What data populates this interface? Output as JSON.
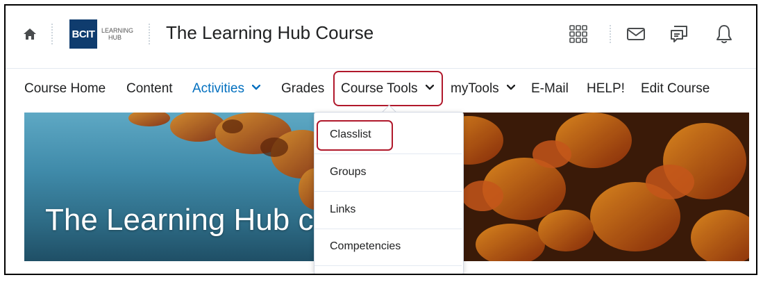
{
  "header": {
    "home_icon": "home-icon",
    "logo": {
      "brand": "BCIT",
      "line1": "LEARNING",
      "line2": "HUB"
    },
    "course_title": "The Learning Hub Course",
    "icons": [
      "apps-grid-icon",
      "mail-icon",
      "chat-icon",
      "bell-icon"
    ]
  },
  "nav": {
    "items": [
      {
        "label": "Course Home"
      },
      {
        "label": "Content"
      },
      {
        "label": "Activities",
        "has_dropdown": true,
        "active": true
      },
      {
        "label": "Grades"
      },
      {
        "label": "Course Tools",
        "has_dropdown": true,
        "highlighted": true
      },
      {
        "label": "myTools",
        "has_dropdown": true
      },
      {
        "label": "E-Mail"
      },
      {
        "label": "HELP!"
      },
      {
        "label": "Edit Course"
      }
    ]
  },
  "banner": {
    "text": "The Learning Hub co"
  },
  "dropdown": {
    "items": [
      {
        "label": "Classlist",
        "highlighted": true
      },
      {
        "label": "Groups"
      },
      {
        "label": "Links"
      },
      {
        "label": "Competencies"
      }
    ]
  },
  "colors": {
    "link_blue": "#006fbf",
    "highlight_red": "#b0182b",
    "logo_navy": "#0f3c6e"
  }
}
